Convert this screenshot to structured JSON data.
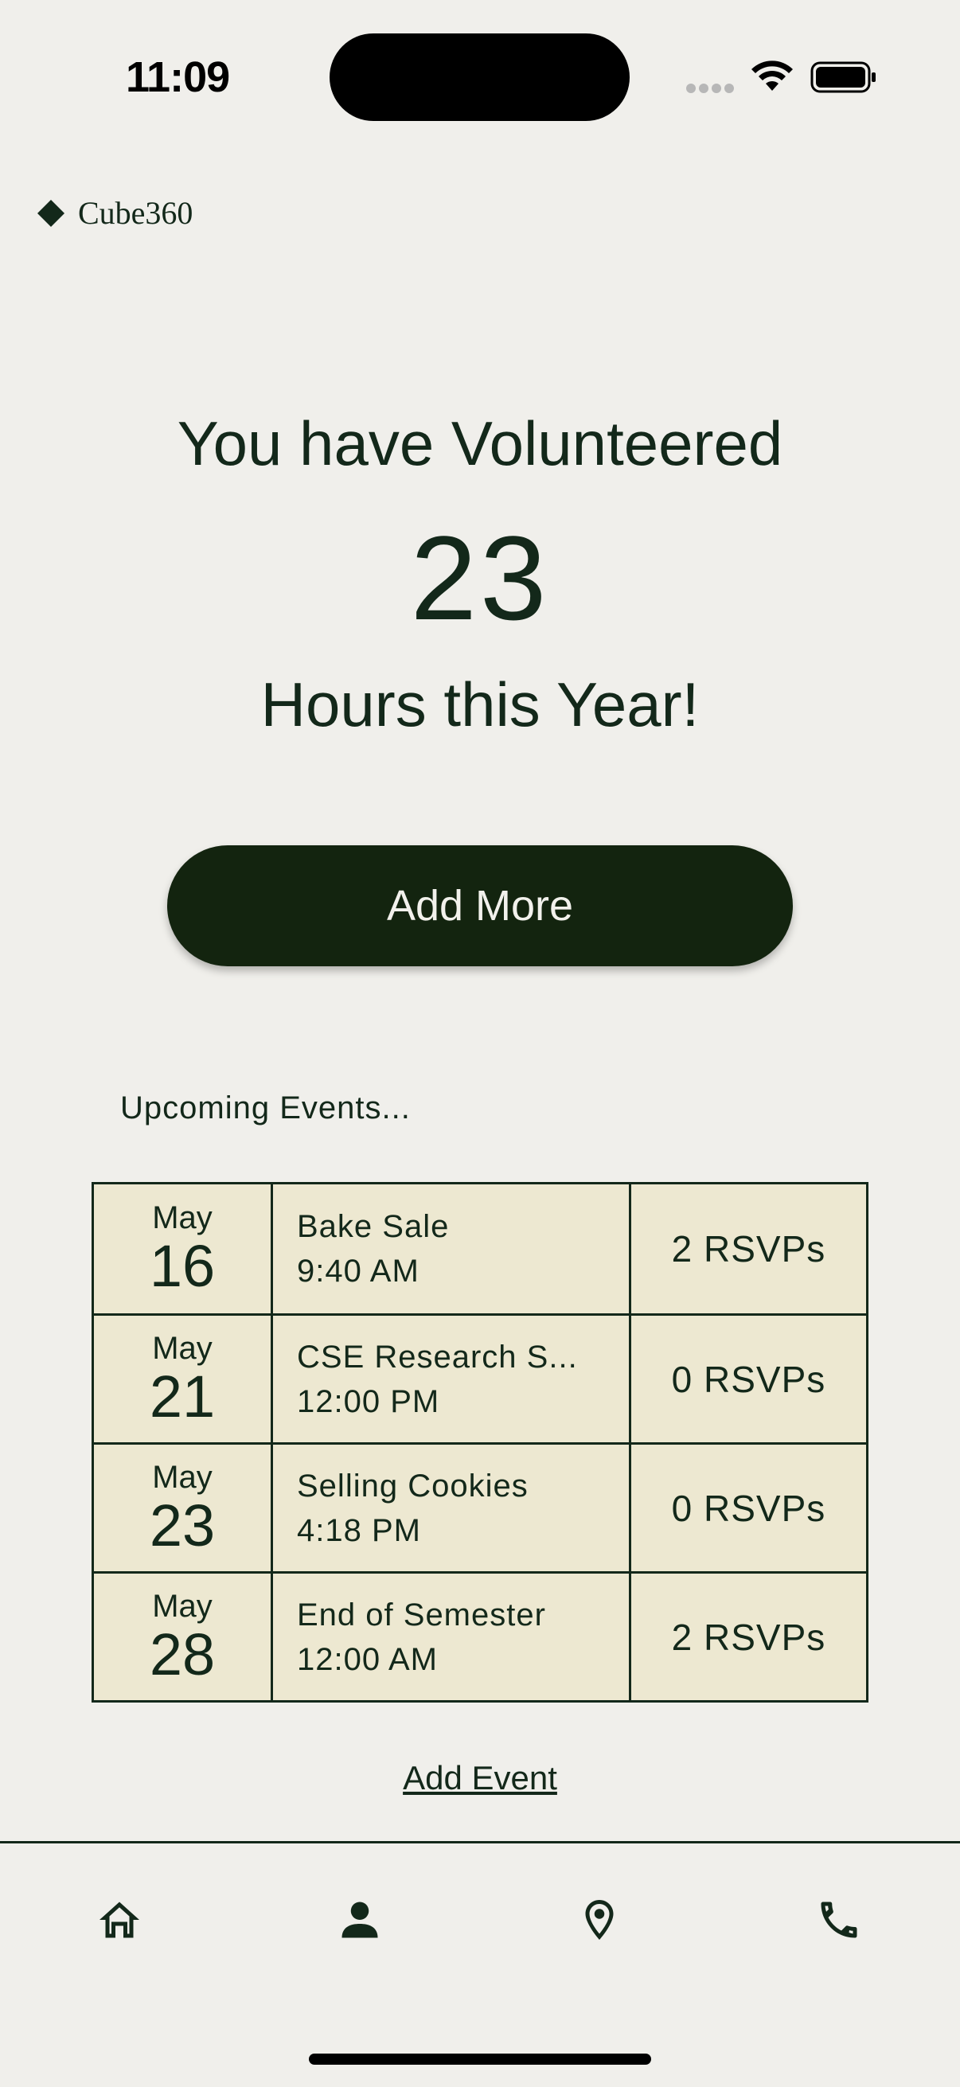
{
  "status_bar": {
    "time": "11:09"
  },
  "app": {
    "logo_text": "Cube360"
  },
  "hero": {
    "line1": "You have Volunteered",
    "hours": "23",
    "line2": "Hours this Year!"
  },
  "actions": {
    "add_more_label": "Add More",
    "add_event_label": "Add Event"
  },
  "events": {
    "section_title": "Upcoming Events...",
    "rows": [
      {
        "month": "May",
        "day": "16",
        "name": "Bake Sale",
        "time": "9:40 AM",
        "rsvps": "2 RSVPs"
      },
      {
        "month": "May",
        "day": "21",
        "name": "CSE Research S...",
        "time": "12:00 PM",
        "rsvps": "0 RSVPs"
      },
      {
        "month": "May",
        "day": "23",
        "name": "Selling Cookies",
        "time": "4:18 PM",
        "rsvps": "0 RSVPs"
      },
      {
        "month": "May",
        "day": "28",
        "name": "End of Semester",
        "time": "12:00 AM",
        "rsvps": "2 RSVPs"
      }
    ]
  },
  "nav": {
    "items": [
      "home-icon",
      "person-icon",
      "location-pin-icon",
      "phone-icon"
    ]
  },
  "colors": {
    "background": "#f0efeb",
    "primary_dark": "#13240f",
    "table_fill": "#ede8d1"
  }
}
